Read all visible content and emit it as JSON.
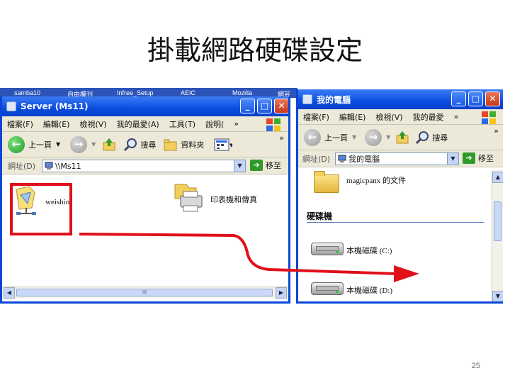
{
  "slide": {
    "title": "掛載網路硬碟設定",
    "page_number": "25"
  },
  "background_tabs": [
    "samba10",
    "自由欄刊",
    "Infree_Setup",
    "AEIC",
    "Mozilla",
    "網芸"
  ],
  "left_window": {
    "title": "Server (Ms11)",
    "menu": [
      "檔案(F)",
      "編輯(E)",
      "檢視(V)",
      "我的最愛(A)",
      "工具(T)",
      "說明("
    ],
    "menu_overflow": "»",
    "toolbar": {
      "back": "上一頁",
      "search": "搜尋",
      "folders": "資料夾",
      "overflow": "»"
    },
    "address": {
      "label": "網址(D)",
      "value": "\\\\Ms11",
      "go": "移至"
    },
    "items": [
      {
        "name": "weishin",
        "icon": "network-share-icon"
      },
      {
        "name": "印表機和傳真",
        "icon": "printer-icon"
      }
    ],
    "scrollbar_mark": "III"
  },
  "right_window": {
    "title": "我的電腦",
    "menu": [
      "檔案(F)",
      "編輯(E)",
      "檢視(V)",
      "我的最愛"
    ],
    "menu_overflow": "»",
    "toolbar": {
      "back": "上一頁",
      "search": "搜尋",
      "overflow": "»"
    },
    "address": {
      "label": "網址(D)",
      "value": "我的電腦",
      "go": "移至"
    },
    "folder_item": "magicpanx 的文件",
    "section_heading": "硬碟機",
    "drives": [
      "本機磁碟 (C:)",
      "本機磁碟 (D:)"
    ]
  },
  "colors": {
    "window_border": "#0a46d8",
    "annotation": "#e0101a"
  }
}
